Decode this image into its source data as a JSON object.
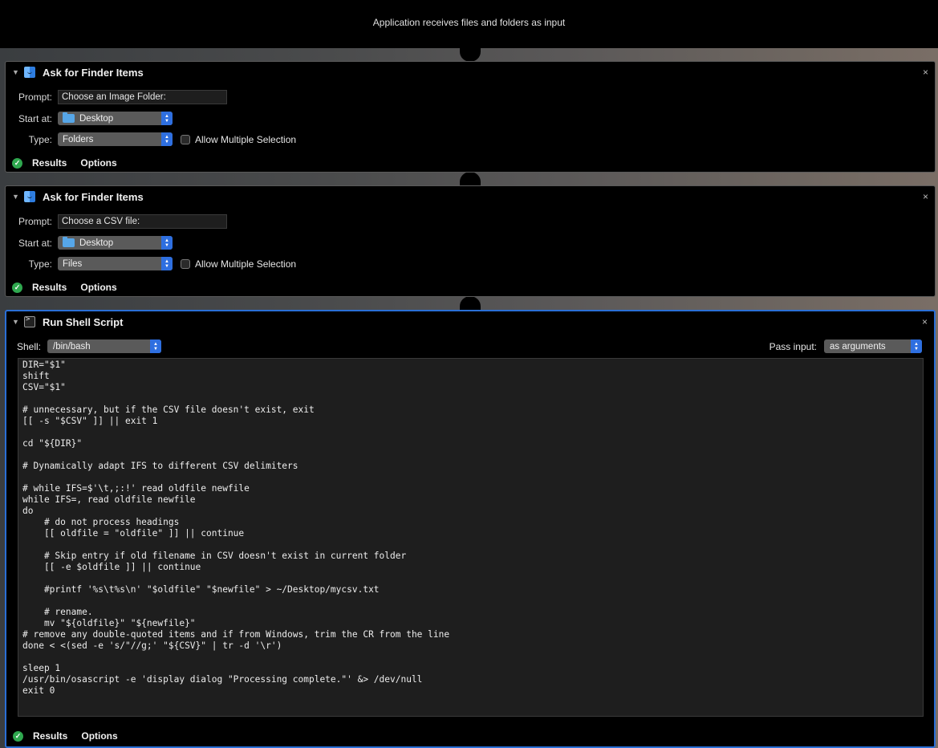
{
  "header": {
    "text": "Application receives files and folders as input"
  },
  "actions": [
    {
      "title": "Ask for Finder Items",
      "close": "×",
      "prompt_label": "Prompt:",
      "prompt_value": "Choose an Image Folder:",
      "start_label": "Start at:",
      "start_value": "Desktop",
      "type_label": "Type:",
      "type_value": "Folders",
      "allow_multiple_label": "Allow Multiple Selection",
      "allow_multiple_checked": false,
      "results_label": "Results",
      "options_label": "Options"
    },
    {
      "title": "Ask for Finder Items",
      "close": "×",
      "prompt_label": "Prompt:",
      "prompt_value": "Choose a CSV file:",
      "start_label": "Start at:",
      "start_value": "Desktop",
      "type_label": "Type:",
      "type_value": "Files",
      "allow_multiple_label": "Allow Multiple Selection",
      "allow_multiple_checked": false,
      "results_label": "Results",
      "options_label": "Options"
    },
    {
      "title": "Run Shell Script",
      "close": "×",
      "shell_label": "Shell:",
      "shell_value": "/bin/bash",
      "pass_input_label": "Pass input:",
      "pass_input_value": "as arguments",
      "results_label": "Results",
      "options_label": "Options",
      "script_lines": [
        "DIR=\"$1\"",
        "shift",
        "CSV=\"$1\"",
        "",
        "# unnecessary, but if the CSV file doesn't exist, exit",
        "[[ -s \"$CSV\" ]] || exit 1",
        "",
        "cd \"${DIR}\"",
        "",
        "# Dynamically adapt IFS to different CSV delimiters",
        "",
        "# while IFS=$'\\t,;:!' read oldfile newfile",
        "while IFS=, read oldfile newfile",
        "do",
        "    # do not process headings",
        "    [[ oldfile = \"oldfile\" ]] || continue",
        "",
        "    # Skip entry if old filename in CSV doesn't exist in current folder",
        "    [[ -e $oldfile ]] || continue",
        "",
        "    #printf '%s\\t%s\\n' \"$oldfile\" \"$newfile\" > ~/Desktop/mycsv.txt",
        "",
        "    # rename.",
        "    mv \"${oldfile}\" \"${newfile}\"",
        "# remove any double-quoted items and if from Windows, trim the CR from the line",
        "done < <(sed -e 's/\"//g;' \"${CSV}\" | tr -d '\\r')",
        "",
        "sleep 1",
        "/usr/bin/osascript -e 'display dialog \"Processing complete.\"' &> /dev/null",
        "exit 0"
      ]
    }
  ]
}
